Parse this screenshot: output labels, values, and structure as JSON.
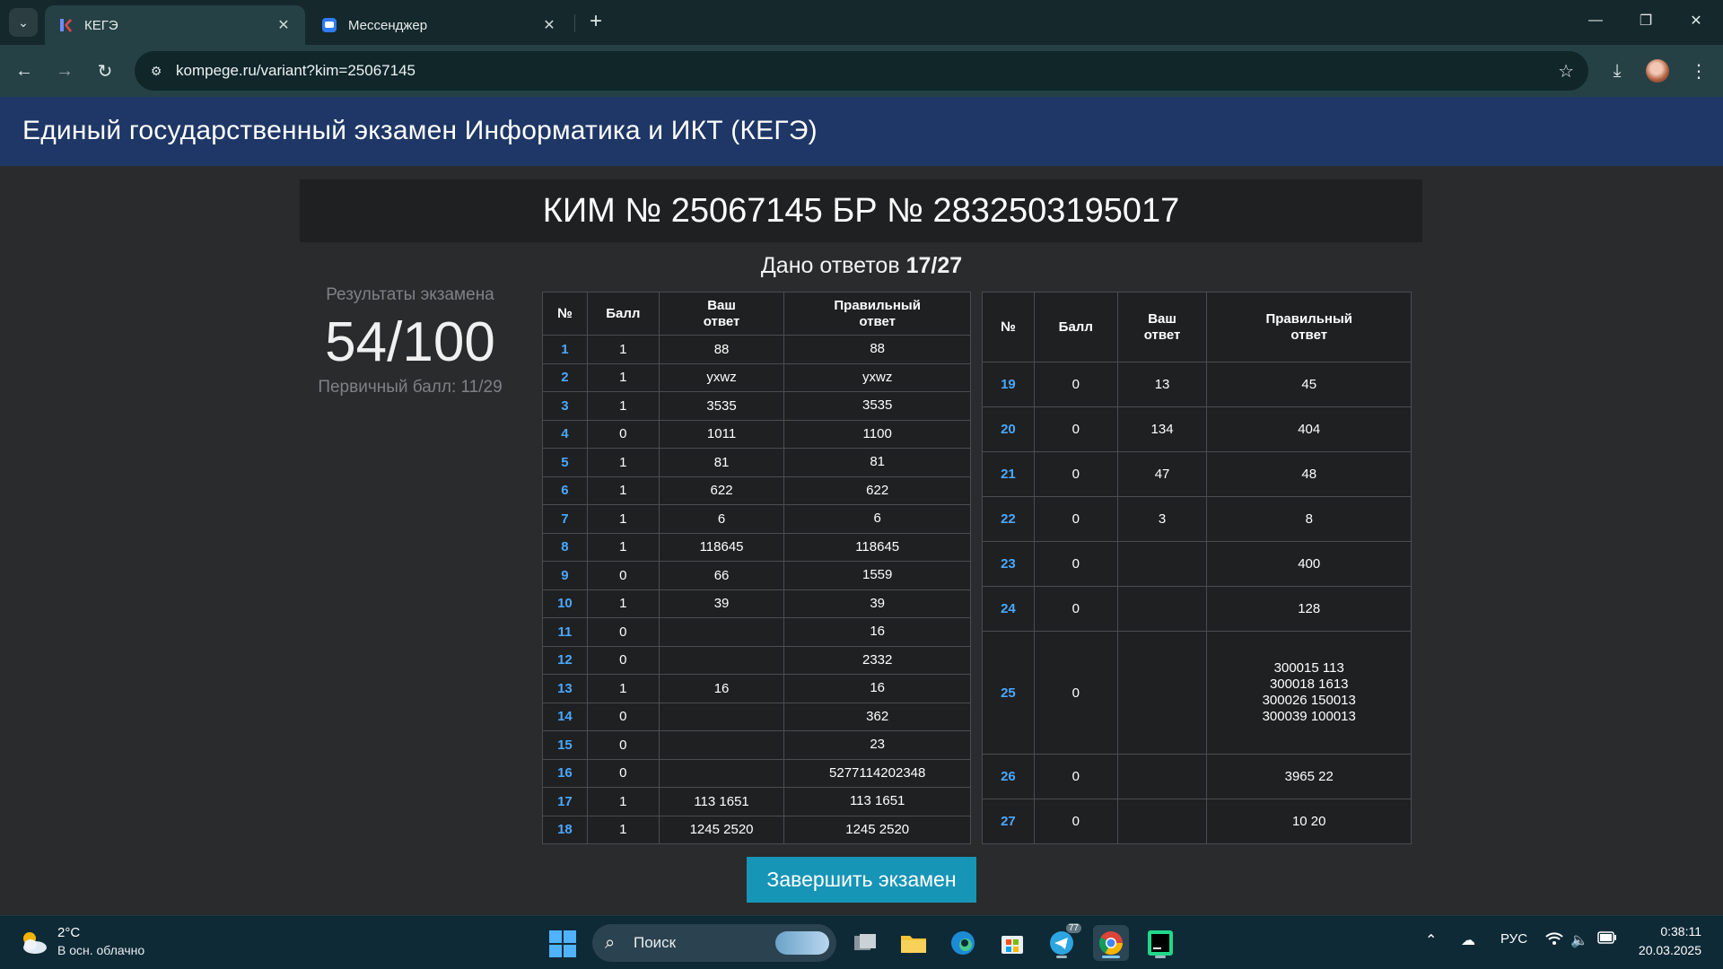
{
  "browser": {
    "tabs": [
      {
        "title": "КЕГЭ",
        "active": true
      },
      {
        "title": "Мессенджер",
        "active": false
      }
    ],
    "url": "kompege.ru/variant?kim=25067145"
  },
  "header": {
    "title": "Единый государственный экзамен Информатика и ИКТ (КЕГЭ)"
  },
  "kim_bar": "КИМ № 25067145 БР № 2832503195017",
  "answers_given": {
    "label": "Дано ответов",
    "value": "17/27"
  },
  "results": {
    "label": "Результаты экзамена",
    "score": "54/100",
    "primary": "Первичный балл: 11/29"
  },
  "table_headers": {
    "num": "№",
    "score": "Балл",
    "your_answer": "Ваш\nответ",
    "correct_answer": "Правильный\nответ"
  },
  "left_rows": [
    {
      "n": "1",
      "score": "1",
      "yours": "88",
      "correct": "88"
    },
    {
      "n": "2",
      "score": "1",
      "yours": "yxwz",
      "correct": "yxwz"
    },
    {
      "n": "3",
      "score": "1",
      "yours": "3535",
      "correct": "3535"
    },
    {
      "n": "4",
      "score": "0",
      "yours": "1011",
      "correct": "1100"
    },
    {
      "n": "5",
      "score": "1",
      "yours": "81",
      "correct": "81"
    },
    {
      "n": "6",
      "score": "1",
      "yours": "622",
      "correct": "622"
    },
    {
      "n": "7",
      "score": "1",
      "yours": "6",
      "correct": "6"
    },
    {
      "n": "8",
      "score": "1",
      "yours": "118645",
      "correct": "118645"
    },
    {
      "n": "9",
      "score": "0",
      "yours": "66",
      "correct": "1559"
    },
    {
      "n": "10",
      "score": "1",
      "yours": "39",
      "correct": "39"
    },
    {
      "n": "11",
      "score": "0",
      "yours": "",
      "correct": "16"
    },
    {
      "n": "12",
      "score": "0",
      "yours": "",
      "correct": "2332"
    },
    {
      "n": "13",
      "score": "1",
      "yours": "16",
      "correct": "16"
    },
    {
      "n": "14",
      "score": "0",
      "yours": "",
      "correct": "362"
    },
    {
      "n": "15",
      "score": "0",
      "yours": "",
      "correct": "23"
    },
    {
      "n": "16",
      "score": "0",
      "yours": "",
      "correct": "5277114202348"
    },
    {
      "n": "17",
      "score": "1",
      "yours": "113 1651",
      "correct": "113 1651"
    },
    {
      "n": "18",
      "score": "1",
      "yours": "1245 2520",
      "correct": "1245 2520"
    }
  ],
  "right_rows": [
    {
      "n": "19",
      "score": "0",
      "yours": "13",
      "correct": "45"
    },
    {
      "n": "20",
      "score": "0",
      "yours": "134",
      "correct": "404"
    },
    {
      "n": "21",
      "score": "0",
      "yours": "47",
      "correct": "48"
    },
    {
      "n": "22",
      "score": "0",
      "yours": "3",
      "correct": "8"
    },
    {
      "n": "23",
      "score": "0",
      "yours": "",
      "correct": "400"
    },
    {
      "n": "24",
      "score": "0",
      "yours": "",
      "correct": "128"
    },
    {
      "n": "25",
      "score": "0",
      "yours": "",
      "correct": "300015 113\n300018 1613\n300026 150013\n300039 100013"
    },
    {
      "n": "26",
      "score": "0",
      "yours": "",
      "correct": "3965 22"
    },
    {
      "n": "27",
      "score": "0",
      "yours": "",
      "correct": "10 20"
    }
  ],
  "finish_button": "Завершить экзамен",
  "taskbar": {
    "weather_temp": "2°C",
    "weather_desc": "В осн. облачно",
    "search_placeholder": "Поиск",
    "telegram_badge": "77",
    "language": "РУС",
    "time": "0:38:11",
    "date": "20.03.2025"
  },
  "colors": {
    "header_bg": "#1e3766",
    "number_link": "#4aa8ff",
    "finish_button": "#1795b7"
  }
}
